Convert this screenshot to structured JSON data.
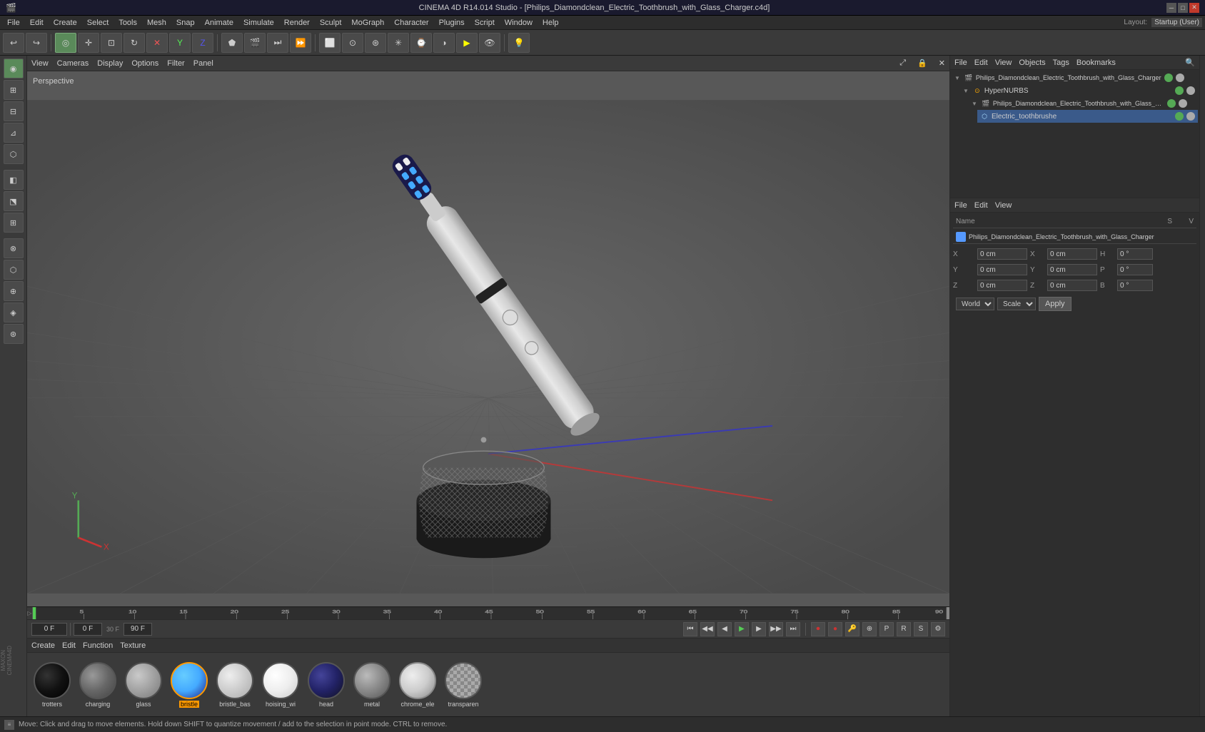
{
  "titlebar": {
    "title": "CINEMA 4D R14.014 Studio - [Philips_Diamondclean_Electric_Toothbrush_with_Glass_Charger.c4d]",
    "app_name": "CINEMA 4D R14.014 Studio"
  },
  "menubar": {
    "items": [
      "File",
      "Edit",
      "Create",
      "Select",
      "Tools",
      "Mesh",
      "Snap",
      "Animate",
      "Simulate",
      "Render",
      "Sculpt",
      "MoGraph",
      "Character",
      "Plugins",
      "Script",
      "Window",
      "Help"
    ]
  },
  "viewport": {
    "label": "Perspective",
    "menus": [
      "View",
      "Cameras",
      "Display",
      "Options",
      "Filter",
      "Panel"
    ]
  },
  "timeline": {
    "frame_start": "0 F",
    "current_frame": "0 F",
    "frame_end": "90 F",
    "fps": "30 F"
  },
  "materials": {
    "menu_items": [
      "Create",
      "Edit",
      "Function",
      "Texture"
    ],
    "items": [
      {
        "name": "trotters",
        "color": "#1a1a1a",
        "type": "dark"
      },
      {
        "name": "charging",
        "color": "#666",
        "type": "metal"
      },
      {
        "name": "glass",
        "color": "#aaa",
        "type": "glass"
      },
      {
        "name": "bristle",
        "color": "#4af",
        "type": "blue",
        "selected": true
      },
      {
        "name": "bristle_bas",
        "color": "#ccc",
        "type": "light"
      },
      {
        "name": "hoising_wi",
        "color": "#eee",
        "type": "white"
      },
      {
        "name": "head",
        "color": "#336",
        "type": "dark_blue"
      },
      {
        "name": "metal",
        "color": "#888",
        "type": "metal2"
      },
      {
        "name": "chrome_ele",
        "color": "#bbb",
        "type": "chrome"
      },
      {
        "name": "transparen",
        "color": "#ccc",
        "type": "transparent"
      }
    ]
  },
  "object_manager": {
    "toolbar_items": [
      "File",
      "Edit",
      "View",
      "Objects",
      "Tags",
      "Bookmarks"
    ],
    "objects": [
      {
        "name": "Philips_Diamondclean_Electric_Toothbrush_with_Glass_Charger",
        "level": 0,
        "icon": "scene"
      },
      {
        "name": "HyperNURBS",
        "level": 1,
        "icon": "nurbs"
      },
      {
        "name": "Philips_Diamondclean_Electric_Toothbrush_with_Glass_Charger",
        "level": 2,
        "icon": "group"
      },
      {
        "name": "Electric_toothbrushe",
        "level": 3,
        "icon": "mesh"
      }
    ]
  },
  "attributes": {
    "toolbar_items": [
      "File",
      "Edit",
      "View"
    ],
    "selected_object": "Philips_Diamondclean_Electric_Toothbrush_with_Glass_Charger",
    "header": {
      "name_col": "Name",
      "s_col": "S",
      "v_col": "V"
    },
    "coords": {
      "x_pos": "0 cm",
      "y_pos": "0 cm",
      "z_pos": "0 cm",
      "x_rot": "0 °",
      "y_rot": "0 °",
      "z_rot": "0 °",
      "h": "0 °",
      "p": "0 °",
      "b": "0 °",
      "x_size": "0 cm",
      "y_size": "0 cm",
      "z_size": "0 cm"
    },
    "coord_space": "World",
    "coord_mode": "Scale",
    "apply_label": "Apply"
  },
  "status_bar": {
    "message": "Move: Click and drag to move elements. Hold down SHIFT to quantize movement / add to the selection in point mode. CTRL to remove."
  },
  "layout": {
    "label": "Layout:",
    "current": "Startup (User)"
  }
}
